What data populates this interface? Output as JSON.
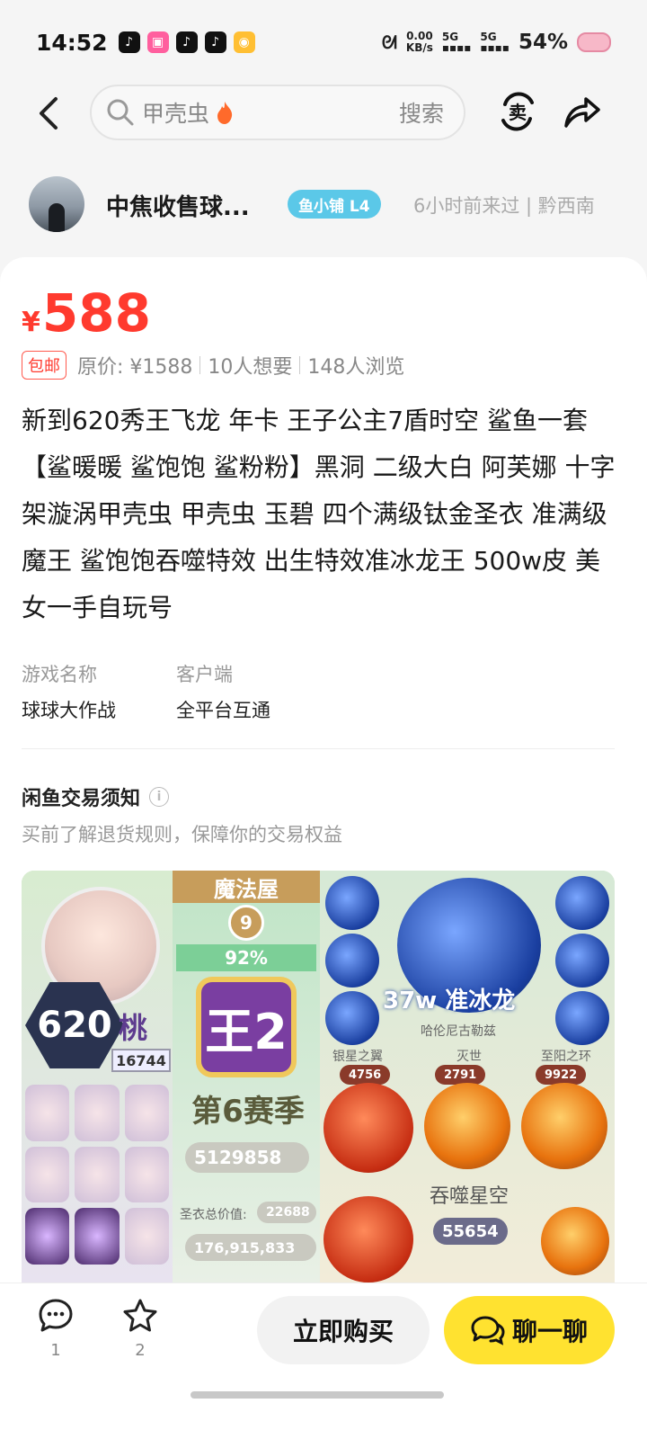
{
  "status_bar": {
    "time": "14:52",
    "net_speed_value": "0.00",
    "net_speed_unit": "KB/s",
    "sig1": "5G",
    "sig2": "5G",
    "battery": "54%"
  },
  "header": {
    "search_text": "甲壳虫",
    "search_button": "搜索"
  },
  "seller": {
    "name": "中焦收售球...",
    "level_badge": "鱼小铺 L4",
    "last_seen": "6小时前来过 | 黔西南"
  },
  "product": {
    "currency": "¥",
    "price": "588",
    "shipping_tag": "包邮",
    "original_price": "原价: ¥1588",
    "wants": "10人想要",
    "views": "148人浏览",
    "description": "新到620秀王飞龙 年卡 王子公主7盾时空 鲨鱼一套【鲨暖暖 鲨饱饱 鲨粉粉】黑洞 二级大白 阿芙娜 十字架漩涡甲壳虫 甲壳虫 玉碧 四个满级钛金圣衣 准满级魔王 鲨饱饱吞噬特效 出生特效准冰龙王 500w皮 美女一手自玩号",
    "attributes": [
      {
        "label": "游戏名称",
        "value": "球球大作战"
      },
      {
        "label": "客户端",
        "value": "全平台互通"
      }
    ]
  },
  "notice": {
    "title": "闲鱼交易须知",
    "subtitle": "买前了解退货规则，保障你的交易权益"
  },
  "game_image": {
    "level": "620",
    "name": "桃",
    "score": "16744",
    "magic_house": "魔法屋",
    "magic_level": "9",
    "percent": "92%",
    "king": "王2",
    "season": "第6赛季",
    "points": "5129858",
    "total_value_label": "圣衣总价值:",
    "total_value": "22688",
    "crown_value": "176,915,833",
    "dragon": "37w 准冰龙",
    "dragon_sub": "哈伦尼古勒兹",
    "orb_labels": [
      "银星之翼",
      "灭世",
      "至阳之环"
    ],
    "orb_counts": [
      "4756",
      "2791",
      "9922"
    ],
    "swallow": "吞噬星空",
    "swallow_count": "55654"
  },
  "bottom_bar": {
    "comment_count": "1",
    "favorite_count": "2",
    "buy_label": "立即购买",
    "chat_label": "聊一聊"
  },
  "colors": {
    "price_red": "#ff3a2e",
    "chat_yellow": "#ffe230",
    "badge_blue": "#5bc8e8"
  }
}
